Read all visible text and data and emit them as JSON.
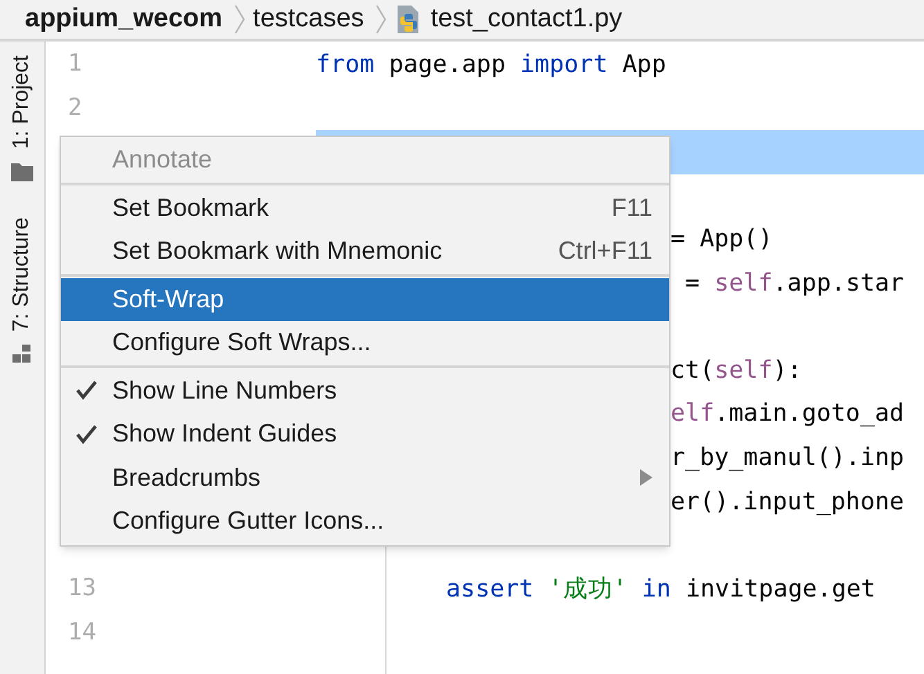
{
  "breadcrumbs": [
    {
      "label": "appium_wecom",
      "kind": "project"
    },
    {
      "label": "testcases",
      "kind": "folder"
    },
    {
      "label": "test_contact1.py",
      "kind": "file"
    }
  ],
  "tool_strip": [
    {
      "label": "1: Project",
      "kind": "folder"
    },
    {
      "label": "7: Structure",
      "kind": "structure"
    }
  ],
  "editor": {
    "lines": [
      {
        "number": "1",
        "kind": "top",
        "current": false,
        "tokens": [
          {
            "text": "from",
            "kind": "keyword"
          },
          {
            "text": " page.app ",
            "kind": "plain"
          },
          {
            "text": "import",
            "kind": "keyword"
          },
          {
            "text": " App",
            "kind": "plain"
          }
        ]
      },
      {
        "number": "2",
        "kind": "top",
        "current": false
      },
      {
        "kind": "top",
        "current": true
      },
      {
        "kind": "clipped",
        "current": false
      },
      {
        "kind": "clipped",
        "current": false,
        "tokens": [
          {
            "text": "= App()",
            "kind": "plain"
          }
        ]
      },
      {
        "kind": "clipped",
        "current": false,
        "tokens": [
          {
            "text": " = ",
            "kind": "plain"
          },
          {
            "text": "self",
            "kind": "self"
          },
          {
            "text": ".app.star",
            "kind": "plain"
          }
        ]
      },
      {
        "kind": "clipped",
        "current": false
      },
      {
        "kind": "clipped",
        "current": false,
        "tokens": [
          {
            "text": "ct(",
            "kind": "plain"
          },
          {
            "text": "self",
            "kind": "self"
          },
          {
            "text": "):",
            "kind": "plain"
          }
        ]
      },
      {
        "kind": "clipped",
        "current": false,
        "tokens": [
          {
            "text": "elf",
            "kind": "self"
          },
          {
            "text": ".main.goto_ad",
            "kind": "plain"
          }
        ]
      },
      {
        "kind": "clipped",
        "current": false,
        "tokens": [
          {
            "text": "r_by_manul().inp",
            "kind": "plain"
          }
        ]
      },
      {
        "kind": "clipped",
        "current": false,
        "tokens": [
          {
            "text": "er().input_phone",
            "kind": "plain"
          }
        ]
      },
      {
        "kind": "body",
        "current": false
      },
      {
        "number": "13",
        "kind": "body",
        "current": false,
        "tokens": [
          {
            "text": "assert",
            "kind": "keyword"
          },
          {
            "text": " '成功'",
            "kind": "string"
          },
          {
            "text": " in",
            "kind": "keyword"
          },
          {
            "text": " invitpage.get",
            "kind": "plain"
          }
        ]
      },
      {
        "number": "14",
        "kind": "body",
        "current": false
      },
      {
        "kind": "body",
        "current": false
      }
    ]
  },
  "context_menu": {
    "groups": [
      [
        {
          "label": "Annotate",
          "disabled": true,
          "selected": false,
          "checked": false
        }
      ],
      [
        {
          "label": "Set Bookmark",
          "shortcut": "F11",
          "disabled": false,
          "selected": false,
          "checked": false
        },
        {
          "label": "Set Bookmark with Mnemonic",
          "shortcut": "Ctrl+F11",
          "disabled": false,
          "selected": false,
          "checked": false
        }
      ],
      [
        {
          "label": "Soft-Wrap",
          "disabled": false,
          "selected": true,
          "checked": false
        },
        {
          "label": "Configure Soft Wraps...",
          "disabled": false,
          "selected": false,
          "checked": false
        }
      ],
      [
        {
          "label": "Show Line Numbers",
          "disabled": false,
          "selected": false,
          "checked": true
        },
        {
          "label": "Show Indent Guides",
          "disabled": false,
          "selected": false,
          "checked": true
        },
        {
          "label": "Breadcrumbs",
          "disabled": false,
          "selected": false,
          "checked": false,
          "submenu": true
        },
        {
          "label": "Configure Gutter Icons...",
          "disabled": false,
          "selected": false,
          "checked": false
        }
      ]
    ]
  }
}
